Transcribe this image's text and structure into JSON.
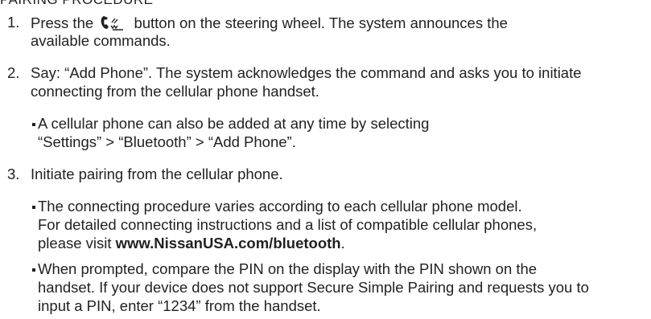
{
  "heading": "PAIRING PROCEDURE",
  "steps": [
    {
      "number": "1.",
      "line1_before": "Press the",
      "line1_after": "button on the steering wheel. The system announces the",
      "line2": "available commands."
    },
    {
      "number": "2.",
      "line1": "Say: “Add Phone”. The system acknowledges the command and asks you to initiate",
      "line2": "connecting from the cellular phone handset.",
      "bullets": [
        {
          "line1": "A cellular phone can also be added at any time by selecting",
          "line2": "“Settings” > “Bluetooth” > “Add Phone”."
        }
      ]
    },
    {
      "number": "3.",
      "line1": "Initiate pairing from the cellular phone.",
      "bullets": [
        {
          "line1": "The connecting procedure varies according to each cellular phone model.",
          "line2": "For detailed connecting instructions and a list of compatible cellular phones,",
          "line3_before": "please visit",
          "line3_url": "www.NissanUSA.com/bluetooth",
          "line3_after": "."
        },
        {
          "line1": "When prompted, compare the PIN on the display with the PIN shown on the",
          "line2": "handset. If your device does not support Secure Simple Pairing and requests you to",
          "line3": "input a PIN, enter “1234” from the handset."
        }
      ]
    }
  ],
  "icons": {
    "phone": "phone-voice-button-icon"
  }
}
